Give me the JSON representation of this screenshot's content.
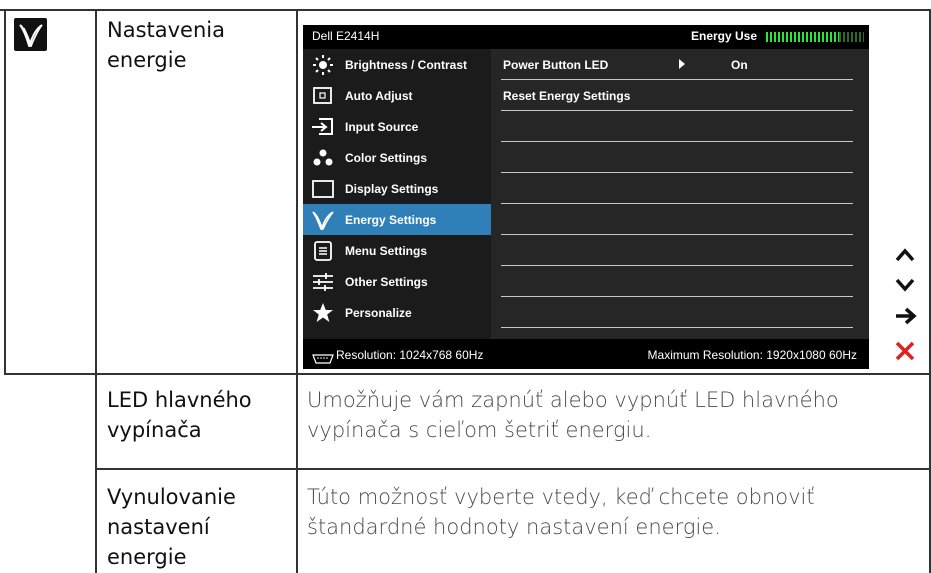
{
  "rows": {
    "energy": {
      "title_line1": "Nastavenia",
      "title_line2": "energie"
    },
    "led": {
      "title_line1": "LED hlavného",
      "title_line2": "vypínača",
      "desc_line1": "Umožňuje vám zapnúť alebo vypnúť LED hlavného",
      "desc_line2": "vypínača s cieľom šetriť energiu."
    },
    "reset": {
      "title_line1": "Vynulovanie",
      "title_line2": "nastavení",
      "title_line3": "energie",
      "desc_line1": "Túto možnosť vyberte vtedy, keď chcete obnoviť",
      "desc_line2": "štandardné hodnoty nastavení energie."
    }
  },
  "osd": {
    "model": "Dell E2414H",
    "energy_use_label": "Energy Use",
    "energy_use_level": 0.75,
    "menu": [
      {
        "label": "Brightness / Contrast",
        "icon": "brightness-icon"
      },
      {
        "label": "Auto Adjust",
        "icon": "auto-adjust-icon"
      },
      {
        "label": "Input Source",
        "icon": "input-source-icon"
      },
      {
        "label": "Color Settings",
        "icon": "color-settings-icon"
      },
      {
        "label": "Display Settings",
        "icon": "display-settings-icon"
      },
      {
        "label": "Energy Settings",
        "icon": "energy-settings-icon",
        "active": true
      },
      {
        "label": "Menu Settings",
        "icon": "menu-settings-icon"
      },
      {
        "label": "Other Settings",
        "icon": "other-settings-icon"
      },
      {
        "label": "Personalize",
        "icon": "star-icon"
      }
    ],
    "submenu": [
      {
        "label": "Power Button LED",
        "value": "On"
      },
      {
        "label": "Reset Energy Settings",
        "value": ""
      }
    ],
    "resolution": "Resolution:  1024x768 60Hz",
    "max_resolution": "Maximum Resolution: 1920x1080 60Hz"
  },
  "nav_buttons": [
    "up-arrow-icon",
    "down-arrow-icon",
    "right-arrow-icon",
    "close-icon"
  ],
  "colors": {
    "active": "#2f7fb8",
    "close": "#e02020",
    "energy_bar": "#2ee632"
  }
}
